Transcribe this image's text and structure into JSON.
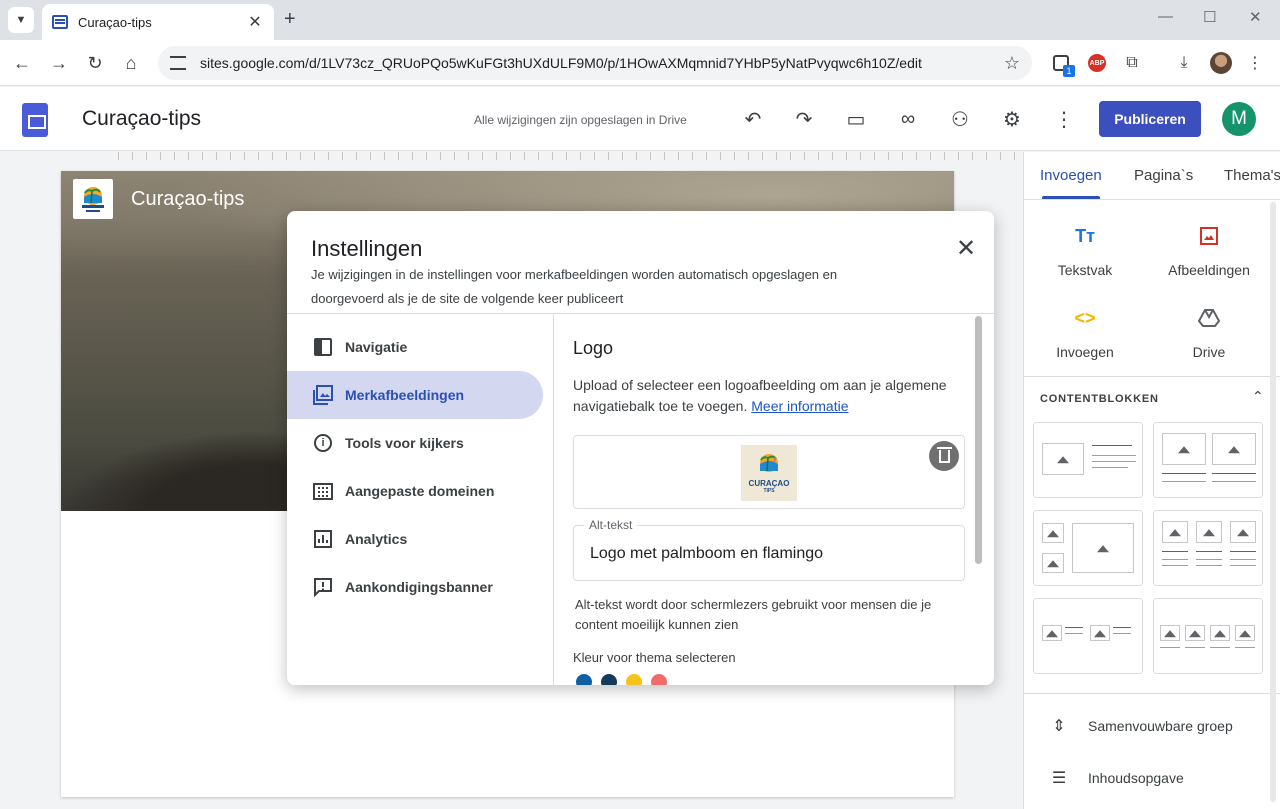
{
  "browser": {
    "tab_title": "Curaçao-tips",
    "url": "sites.google.com/d/1LV73cz_QRUoPQo5wKuFGt3hUXdULF9M0/p/1HOwAXMqmnid7YHbP5yNatPvyqwc6h10Z/edit",
    "ext_badge": "1",
    "abp_label": "ABP"
  },
  "app": {
    "doc_title": "Curaçao-tips",
    "save_status": "Alle wijzigingen zijn opgeslagen in Drive",
    "publish_label": "Publiceren",
    "avatar_letter": "M"
  },
  "page": {
    "site_title": "Curaçao-tips"
  },
  "dialog": {
    "title": "Instellingen",
    "subtitle": "Je wijzigingen in de instellingen voor merkafbeeldingen worden automatisch opgeslagen en doorgevoerd als je de site de volgende keer publiceert",
    "nav": [
      {
        "label": "Navigatie"
      },
      {
        "label": "Merkafbeeldingen"
      },
      {
        "label": "Tools voor kijkers"
      },
      {
        "label": "Aangepaste domeinen"
      },
      {
        "label": "Analytics"
      },
      {
        "label": "Aankondigingsbanner"
      }
    ],
    "active_nav": "Merkafbeeldingen",
    "section_title": "Logo",
    "section_desc": "Upload of selecteer een logoafbeelding om aan je algemene navigatiebalk toe te voegen.",
    "learn_more": "Meer informatie",
    "logo_text": "CURAÇAO",
    "logo_subtext": "TIPS",
    "alt_label": "Alt-tekst",
    "alt_value": "Logo met palmboom en flamingo",
    "alt_hint": "Alt-tekst wordt door schermlezers gebruikt voor mensen die je content moeilijk kunnen zien",
    "color_label": "Kleur voor thema selecteren",
    "theme_colors": [
      "#0e5fa3",
      "#123b5e",
      "#f6c21c",
      "#f26b6b"
    ]
  },
  "sidepanel": {
    "tabs": [
      "Invoegen",
      "Pagina`s",
      "Thema's"
    ],
    "active_tab": "Invoegen",
    "insert_items": [
      {
        "label": "Tekstvak",
        "icon": "text-icon"
      },
      {
        "label": "Afbeeldingen",
        "icon": "image-icon"
      },
      {
        "label": "Invoegen",
        "icon": "embed-icon"
      },
      {
        "label": "Drive",
        "icon": "drive-icon"
      }
    ],
    "content_blocks_title": "CONTENTBLOKKEN",
    "list_items": [
      {
        "label": "Samenvouwbare groep",
        "icon": "collapsible-icon"
      },
      {
        "label": "Inhoudsopgave",
        "icon": "toc-icon"
      }
    ]
  },
  "colors": {
    "accent": "#3c4fbf",
    "active_nav_bg": "#d3d8f0",
    "avatar": "#15946b"
  }
}
